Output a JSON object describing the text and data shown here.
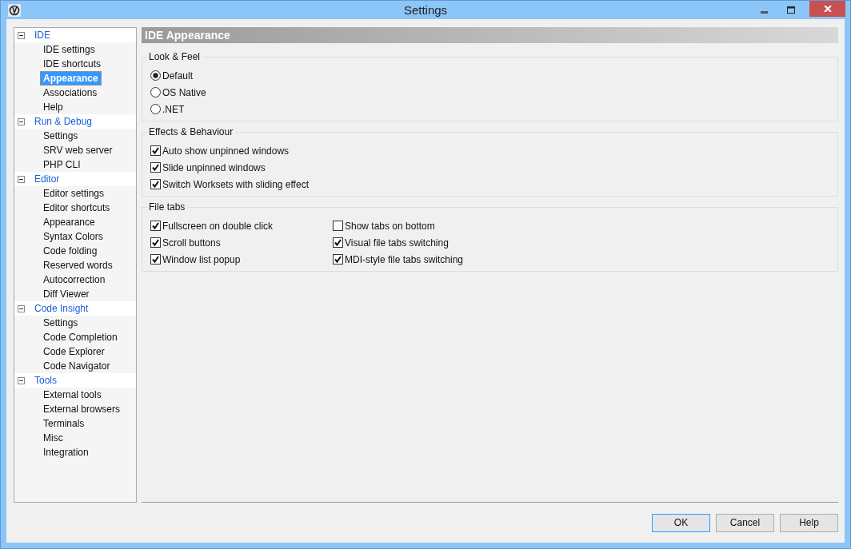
{
  "window": {
    "title": "Settings"
  },
  "tree": [
    {
      "label": "IDE",
      "expanded": true,
      "children": [
        {
          "label": "IDE settings",
          "selected": false
        },
        {
          "label": "IDE shortcuts",
          "selected": false
        },
        {
          "label": "Appearance",
          "selected": true
        },
        {
          "label": "Associations",
          "selected": false
        },
        {
          "label": "Help",
          "selected": false
        }
      ]
    },
    {
      "label": "Run & Debug",
      "expanded": true,
      "children": [
        {
          "label": "Settings",
          "selected": false
        },
        {
          "label": "SRV web server",
          "selected": false
        },
        {
          "label": "PHP CLI",
          "selected": false
        }
      ]
    },
    {
      "label": "Editor",
      "expanded": true,
      "children": [
        {
          "label": "Editor settings",
          "selected": false
        },
        {
          "label": "Editor shortcuts",
          "selected": false
        },
        {
          "label": "Appearance",
          "selected": false
        },
        {
          "label": "Syntax Colors",
          "selected": false
        },
        {
          "label": "Code folding",
          "selected": false
        },
        {
          "label": "Reserved words",
          "selected": false
        },
        {
          "label": "Autocorrection",
          "selected": false
        },
        {
          "label": "Diff Viewer",
          "selected": false
        }
      ]
    },
    {
      "label": "Code Insight",
      "expanded": true,
      "children": [
        {
          "label": "Settings",
          "selected": false
        },
        {
          "label": "Code Completion",
          "selected": false
        },
        {
          "label": "Code Explorer",
          "selected": false
        },
        {
          "label": "Code Navigator",
          "selected": false
        }
      ]
    },
    {
      "label": "Tools",
      "expanded": true,
      "children": [
        {
          "label": "External tools",
          "selected": false
        },
        {
          "label": "External browsers",
          "selected": false
        },
        {
          "label": "Terminals",
          "selected": false
        },
        {
          "label": "Misc",
          "selected": false
        },
        {
          "label": "Integration",
          "selected": false
        }
      ]
    }
  ],
  "page_title": "IDE Appearance",
  "groups": [
    {
      "title": "Look & Feel",
      "kind": "radio",
      "columns": [
        [
          {
            "label": "Default",
            "selected": true
          },
          {
            "label": "OS Native",
            "selected": false
          },
          {
            "label": ".NET",
            "selected": false
          }
        ]
      ]
    },
    {
      "title": "Effects & Behaviour",
      "kind": "checkbox",
      "columns": [
        [
          {
            "label": "Auto show unpinned windows",
            "checked": true
          },
          {
            "label": "Slide unpinned windows",
            "checked": true
          },
          {
            "label": "Switch Worksets with sliding effect",
            "checked": true
          }
        ]
      ]
    },
    {
      "title": "File tabs",
      "kind": "checkbox",
      "columns": [
        [
          {
            "label": "Fullscreen on double click",
            "checked": true
          },
          {
            "label": "Scroll buttons",
            "checked": true
          },
          {
            "label": "Window list popup",
            "checked": true
          }
        ],
        [
          {
            "label": "Show tabs on bottom",
            "checked": false
          },
          {
            "label": "Visual file tabs switching",
            "checked": true
          },
          {
            "label": "MDI-style file tabs switching",
            "checked": true
          }
        ]
      ]
    }
  ],
  "buttons": [
    {
      "label": "OK",
      "default": true
    },
    {
      "label": "Cancel",
      "default": false
    },
    {
      "label": "Help",
      "default": false
    }
  ]
}
